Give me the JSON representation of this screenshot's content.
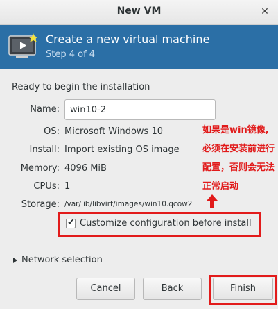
{
  "window": {
    "title": "New VM",
    "close_icon": "close-icon"
  },
  "banner": {
    "title": "Create a new virtual machine",
    "step": "Step 4 of 4",
    "icon": "vm-monitor-icon",
    "bg_color": "#2b6fa6"
  },
  "summary": {
    "heading": "Ready to begin the installation",
    "name_label": "Name:",
    "name_value": "win10-2",
    "os_label": "OS:",
    "os_value": "Microsoft Windows 10",
    "install_label": "Install:",
    "install_value": "Import existing OS image",
    "memory_label": "Memory:",
    "memory_value": "4096 MiB",
    "cpus_label": "CPUs:",
    "cpus_value": "1",
    "storage_label": "Storage:",
    "storage_value": "/var/lib/libvirt/images/win10.qcow2"
  },
  "customize": {
    "label": "Customize configuration before install",
    "checked": true
  },
  "network": {
    "label": "Network selection",
    "expanded": false
  },
  "annotation": {
    "lines": [
      "如果是win镜像,",
      "必须在安装前进行",
      "配置，否则会无法",
      "正常启动"
    ],
    "color": "#e11a1a"
  },
  "buttons": {
    "cancel": "Cancel",
    "back": "Back",
    "finish": "Finish"
  }
}
